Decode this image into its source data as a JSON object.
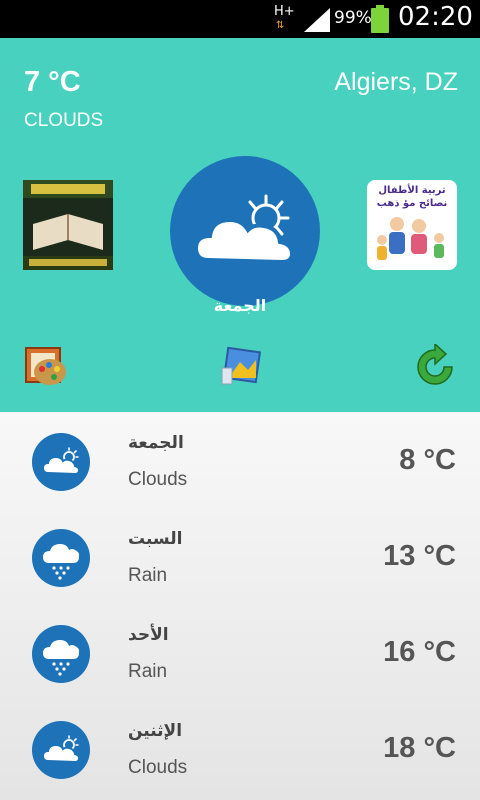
{
  "status_bar": {
    "network": "H+",
    "battery": "99%",
    "time": "02:20"
  },
  "current": {
    "temperature": "7 °C",
    "condition": "CLOUDS",
    "city": "Algiers, DZ",
    "day": "الجمعة",
    "icon": "partly-cloudy-icon"
  },
  "ads": {
    "left_icon": "quran-book-icon",
    "right_title": "تربية الأطفال نصائح مؤ ذهب",
    "right_icon": "family-icon"
  },
  "toolbar": {
    "items": [
      "palette-icon",
      "image-icon",
      "refresh-icon"
    ]
  },
  "forecast": [
    {
      "day": "الجمعة",
      "desc": "Clouds",
      "temp": "8 °C",
      "icon": "partly-cloudy-icon"
    },
    {
      "day": "السبت",
      "desc": "Rain",
      "temp": "13 °C",
      "icon": "rain-cloud-icon"
    },
    {
      "day": "الأحد",
      "desc": "Rain",
      "temp": "16 °C",
      "icon": "rain-cloud-icon"
    },
    {
      "day": "الإثنين",
      "desc": "Clouds",
      "temp": "18 °C",
      "icon": "partly-cloudy-icon"
    }
  ],
  "colors": {
    "header": "#48d1bf",
    "icon_circle": "#1e73b8"
  }
}
